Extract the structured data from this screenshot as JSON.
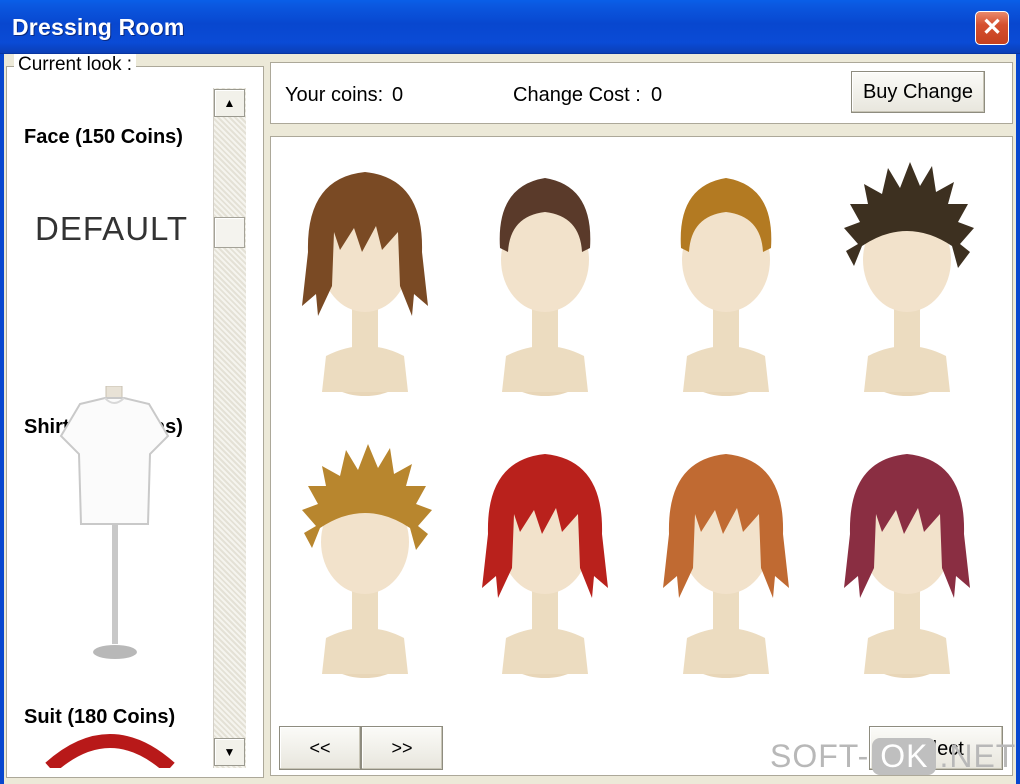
{
  "window": {
    "title": "Dressing Room",
    "close_icon": "close-icon",
    "accent": "#0847cf",
    "close_color": "#d5502f"
  },
  "left_panel": {
    "legend": "Current look :",
    "categories": [
      {
        "id": "face",
        "title": "Face (150 Coins)",
        "value": "DEFAULT"
      },
      {
        "id": "shirt",
        "title": "Shirt (100 Coins)"
      },
      {
        "id": "suit",
        "title": "Suit (180 Coins)"
      }
    ],
    "scroll_up": "▲",
    "scroll_down": "▼"
  },
  "top_bar": {
    "coins_label": "Your coins:",
    "coins_value": "0",
    "cost_label": "Change Cost :",
    "cost_value": "0",
    "buy_button": "Buy Change"
  },
  "hair_grid": {
    "items": [
      {
        "style": "shaggy",
        "color": "#7a4a24"
      },
      {
        "style": "short",
        "color": "#5a3a2a"
      },
      {
        "style": "short",
        "color": "#b37a22"
      },
      {
        "style": "spiky",
        "color": "#3d3020"
      },
      {
        "style": "spiky",
        "color": "#b8862e"
      },
      {
        "style": "shaggy",
        "color": "#b9211c"
      },
      {
        "style": "shaggy",
        "color": "#c06a32"
      },
      {
        "style": "shaggy",
        "color": "#8a2e42"
      }
    ]
  },
  "nav": {
    "prev_label": "<<",
    "next_label": ">>",
    "select_label": "Select"
  },
  "watermark": {
    "pre": "SOFT-",
    "ok": "OK",
    "post": ".NET"
  }
}
